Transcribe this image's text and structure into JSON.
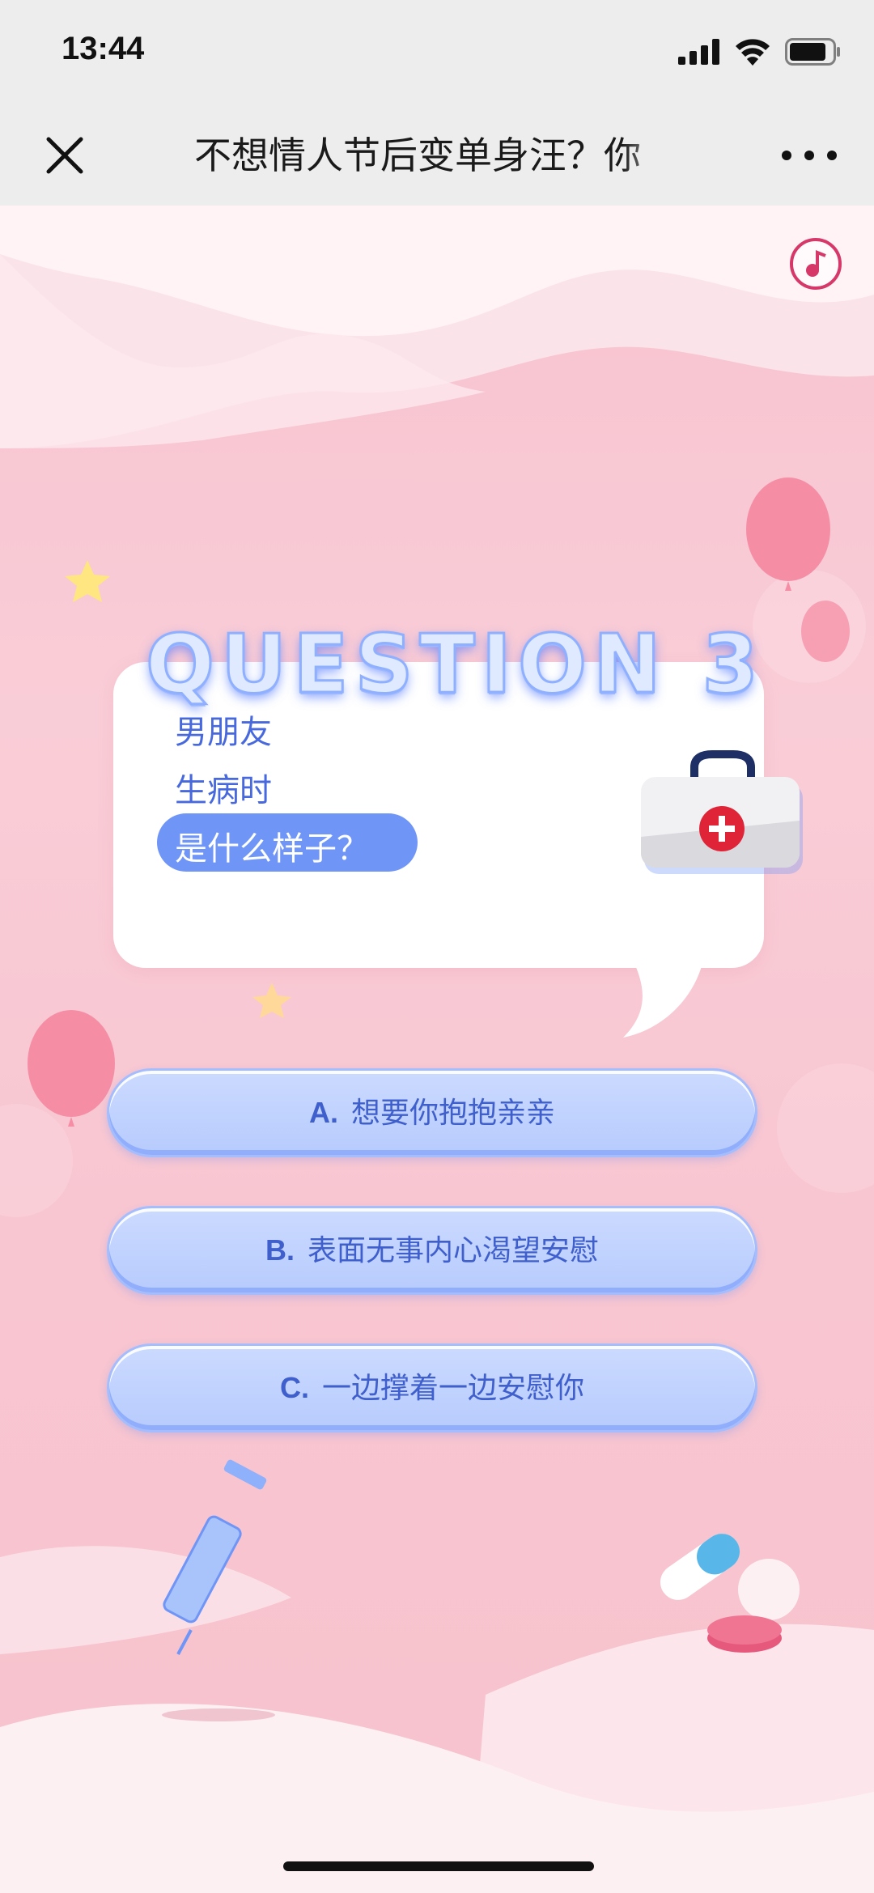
{
  "status_bar": {
    "time": "13:44",
    "icons": [
      "signal-icon",
      "wifi-icon",
      "battery-icon"
    ]
  },
  "nav": {
    "title": "不想情人节后变单身汪？你",
    "close_icon": "close-icon",
    "more_icon": "more-icon"
  },
  "music_icon": "music-note-icon",
  "question": {
    "heading": "QUESTION 3",
    "lines": [
      "男朋友",
      "生病时",
      "是什么样子？"
    ]
  },
  "answers": [
    {
      "letter": "A.",
      "text": "想要你抱抱亲亲"
    },
    {
      "letter": "B.",
      "text": "表面无事内心渴望安慰"
    },
    {
      "letter": "C.",
      "text": "一边撑着一边安慰你"
    }
  ],
  "colors": {
    "accent": "#6f95f7",
    "question_text": "#4769dd",
    "background": "#f7c2cf",
    "answer_bg": "#c1d3fe"
  }
}
